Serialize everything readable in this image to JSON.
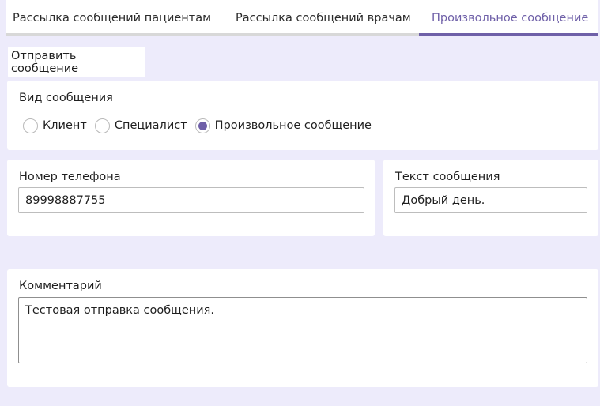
{
  "tabs": [
    {
      "label": "Рассылка сообщений пациентам",
      "active": false
    },
    {
      "label": "Рассылка сообщений врачам",
      "active": false
    },
    {
      "label": "Произвольное сообщение",
      "active": true
    }
  ],
  "toolbar": {
    "send_label": "Отправить сообщение"
  },
  "message_type": {
    "label": "Вид сообщения",
    "options": [
      {
        "label": "Клиент",
        "checked": false
      },
      {
        "label": "Специалист",
        "checked": false
      },
      {
        "label": "Произвольное сообщение",
        "checked": true
      }
    ]
  },
  "phone": {
    "label": "Номер телефона",
    "value": "89998887755"
  },
  "message_text": {
    "label": "Текст сообщения",
    "value": "Добрый день."
  },
  "comment": {
    "label": "Комментарий",
    "value": "Тестовая отправка сообщения."
  },
  "colors": {
    "accent": "#6f60a8",
    "background": "#edebfb"
  }
}
